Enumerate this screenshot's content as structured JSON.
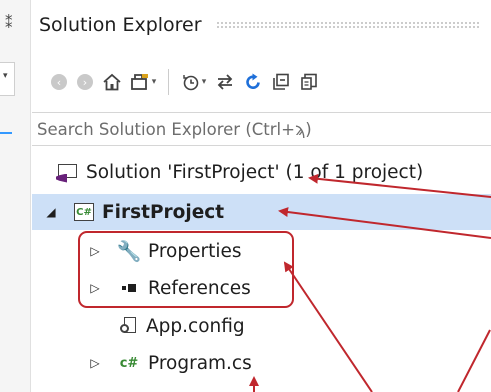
{
  "panel": {
    "title": "Solution Explorer"
  },
  "search": {
    "placeholder": "Search Solution Explorer (Ctrl+ϡ)"
  },
  "toolbar": {
    "buttons": [
      {
        "name": "back",
        "icon": "back-arrow-icon"
      },
      {
        "name": "forward",
        "icon": "forward-arrow-icon"
      },
      {
        "name": "home",
        "icon": "home-icon"
      },
      {
        "name": "switch-views",
        "icon": "switch-views-icon"
      },
      {
        "name": "pending-changes",
        "icon": "history-clock-icon"
      },
      {
        "name": "sync",
        "icon": "sync-arrows-icon"
      },
      {
        "name": "refresh",
        "icon": "refresh-icon"
      },
      {
        "name": "collapse-all",
        "icon": "collapse-all-icon"
      },
      {
        "name": "show-all-files",
        "icon": "show-all-files-icon"
      }
    ]
  },
  "tree": {
    "solution": "Solution 'FirstProject' (1 of 1 project)",
    "project": "FirstProject",
    "properties": "Properties",
    "references": "References",
    "app_config": "App.config",
    "program": "Program.cs"
  },
  "colors": {
    "selection": "#cde0f7",
    "annotation": "#c0272d",
    "csharp": "#388a34",
    "vs_purple": "#68217a",
    "refresh_blue": "#1e6fd9"
  }
}
